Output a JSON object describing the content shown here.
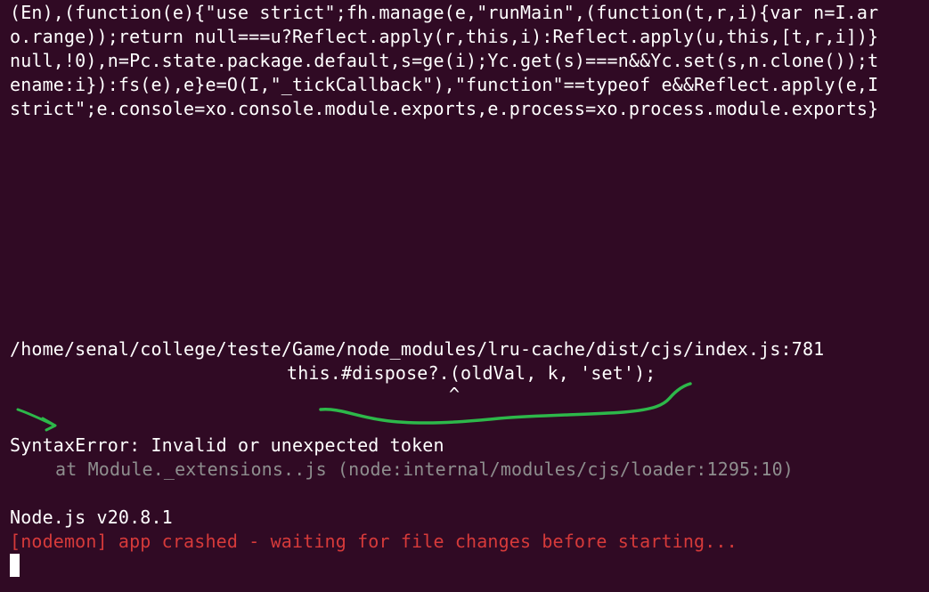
{
  "terminal": {
    "background": "#300a24",
    "minified_source_lines": [
      "(En),(function(e){\"use strict\";fh.manage(e,\"runMain\",(function(t,r,i){var n=I.ar",
      "o.range));return null===u?Reflect.apply(r,this,i):Reflect.apply(u,this,[t,r,i])}",
      "null,!0),n=Pc.state.package.default,s=ge(i);Yc.get(s)===n&&Yc.set(s,n.clone());t",
      "ename:i}):fs(e),e}e=O(I,\"_tickCallback\"),\"function\"==typeof e&&Reflect.apply(e,I",
      "strict\";e.console=xo.console.module.exports,e.process=xo.process.module.exports}"
    ],
    "error_location": "/home/senal/college/teste/Game/node_modules/lru-cache/dist/cjs/index.js:781",
    "error_source_line": "this.#dispose?.(oldVal, k, 'set');",
    "error_caret": "^",
    "error_message": "SyntaxError: Invalid or unexpected token",
    "stack_frame": "at Module._extensions..js (node:internal/modules/cjs/loader:1295:10)",
    "node_version": "Node.js v20.8.1",
    "nodemon_status": "[nodemon] app crashed - waiting for file changes before starting...",
    "colors": {
      "text": "#ffffff",
      "dim_text": "#8e8e8e",
      "nodemon_red": "#d63a3a",
      "annotation_green": "#2db84a"
    }
  }
}
